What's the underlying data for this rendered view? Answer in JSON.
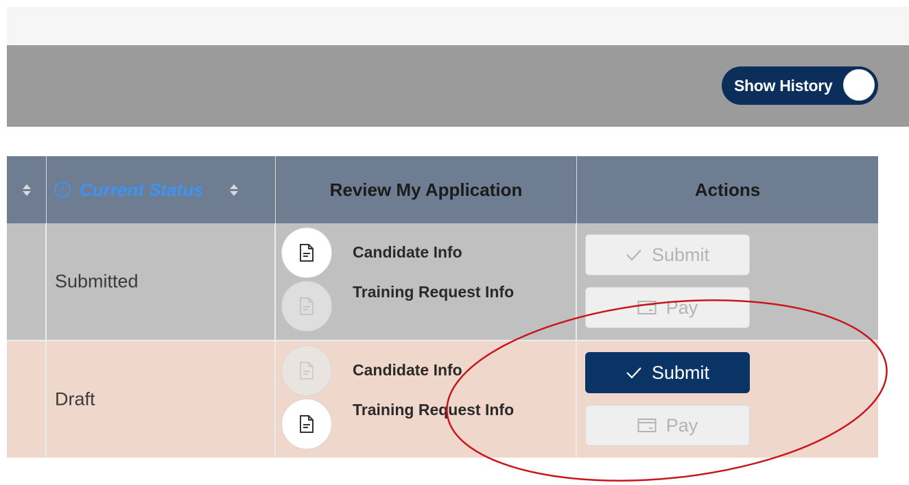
{
  "header": {
    "toggle_label": "Show History"
  },
  "table": {
    "columns": {
      "status": "Current Status",
      "review": "Review My Application",
      "actions": "Actions"
    },
    "rows": [
      {
        "status": "Submitted",
        "docs": [
          "Candidate Info",
          "Training Request Info"
        ],
        "actions": {
          "submit": "Submit",
          "pay": "Pay"
        }
      },
      {
        "status": "Draft",
        "docs": [
          "Candidate Info",
          "Training Request Info"
        ],
        "actions": {
          "submit": "Submit",
          "pay": "Pay"
        }
      }
    ]
  },
  "colors": {
    "header_bg": "#6e7d91",
    "submitted_row": "#c0c0c0",
    "draft_row": "#efd7cb",
    "primary_button": "#0b3466",
    "status_header_text": "#3c94f4",
    "annotation_ellipse": "#c8161d"
  },
  "icons": [
    "info-icon",
    "sort-icon",
    "document-icon",
    "check-icon",
    "card-icon"
  ]
}
